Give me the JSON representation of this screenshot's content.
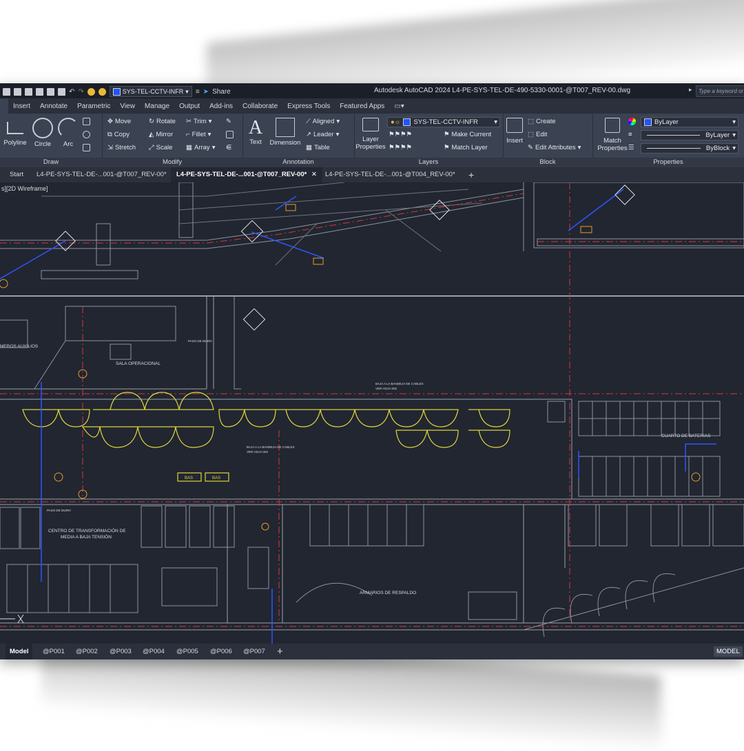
{
  "app": {
    "title": "Autodesk AutoCAD 2024   L4-PE-SYS-TEL-DE-490-5330-0001-@T007_REV-00.dwg",
    "share_label": "Share",
    "search_placeholder": "Type a keyword or phrase",
    "quick_layer": "SYS-TEL-CCTV-INFR"
  },
  "menu": {
    "tabs": [
      "Insert",
      "Annotate",
      "Parametric",
      "View",
      "Manage",
      "Output",
      "Add-ins",
      "Collaborate",
      "Express Tools",
      "Featured Apps"
    ]
  },
  "ribbon": {
    "draw": {
      "title": "Draw",
      "polyline": "Polyline",
      "circle": "Circle",
      "arc": "Arc"
    },
    "modify": {
      "title": "Modify",
      "move": "Move",
      "rotate": "Rotate",
      "trim": "Trim",
      "copy": "Copy",
      "mirror": "Mirror",
      "fillet": "Fillet",
      "stretch": "Stretch",
      "scale": "Scale",
      "array": "Array"
    },
    "annotation": {
      "title": "Annotation",
      "text": "Text",
      "dimension": "Dimension",
      "aligned": "Aligned",
      "leader": "Leader",
      "table": "Table"
    },
    "layers": {
      "title": "Layers",
      "layer_properties": "Layer Properties",
      "current_layer": "SYS-TEL-CCTV-INFR",
      "make_current": "Make Current",
      "match_layer": "Match Layer"
    },
    "block": {
      "title": "Block",
      "insert": "Insert",
      "create": "Create",
      "edit": "Edit",
      "edit_attributes": "Edit Attributes"
    },
    "properties": {
      "title": "Properties",
      "match_properties": "Match Properties",
      "color": "ByLayer",
      "linetype": "ByLayer",
      "lineweight": "ByBlock"
    }
  },
  "doc_tabs": [
    {
      "label": "Start"
    },
    {
      "label": "L4-PE-SYS-TEL-DE-...001-@T007_REV-00*"
    },
    {
      "label": "L4-PE-SYS-TEL-DE-...001-@T007_REV-00*"
    },
    {
      "label": "L4-PE-SYS-TEL-DE-...001-@T004_REV-00*"
    }
  ],
  "viewport": {
    "label": "s][2D Wireframe]"
  },
  "drawing_labels": {
    "auxiliary_room": "MEROS AUXILIOS",
    "operations_room": "SALA OPERACIONAL",
    "battery_room": "CUARTO DE BATERIAS",
    "transformation": "CENTRO DE TRANSFORMACIÓN DE",
    "transformation2": "MEDIA A BAJA TENSIÓN",
    "backup_cabinets": "ARMARIOS DE RESPALDO",
    "cable_note_1": "BAJA A LA BANDEJA DE CABLES",
    "cable_note_2": "VER HOJA 002",
    "wall_pass": "PASO DE MURO",
    "bas_1": "BAS",
    "bas_2": "BAS"
  },
  "layouts": {
    "tabs": [
      "Model",
      "@P001",
      "@P002",
      "@P003",
      "@P004",
      "@P005",
      "@P006",
      "@P007"
    ],
    "mode_button": "MODEL"
  }
}
